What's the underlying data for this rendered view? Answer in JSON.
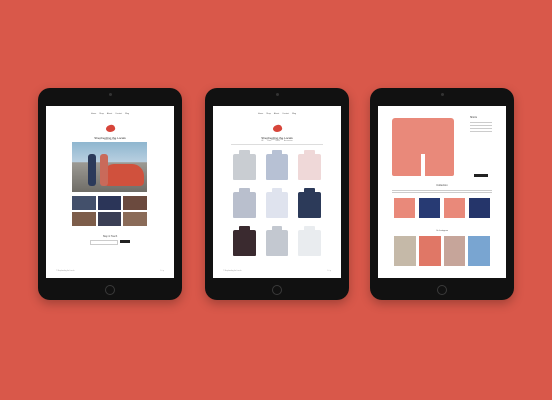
{
  "colors": {
    "background": "#d9584a",
    "brand_red": "#d7453a",
    "tablet_bezel": "#111111"
  },
  "tablet1": {
    "page": "home",
    "nav": [
      "Home",
      "Shop",
      "About",
      "Contact",
      "Blog"
    ],
    "logo_name": "Shepherding the Locals",
    "logo_tag": "Made in the USA",
    "signup_title": "Stay in Touch",
    "footer": [
      "© Shepherding the Locals",
      "f t i p"
    ]
  },
  "tablet2": {
    "page": "shop",
    "nav": [
      "Home",
      "Shop",
      "About",
      "Contact",
      "Blog"
    ],
    "logo_name": "Shepherding the Locals",
    "logo_tag": "Made in the USA",
    "filters": [
      "All",
      "Shirts",
      "Shorts",
      "Accessories"
    ],
    "shirt_colors": [
      "#c9cdd2",
      "#b7c1d4",
      "#efd8d8",
      "#b9bfcd",
      "#dfe3ee",
      "#2c3a59",
      "#3a2a2f",
      "#c3c8d0",
      "#e9ecef"
    ]
  },
  "tablet3": {
    "page": "product",
    "product_title": "Shorts",
    "collection_title": "Collection",
    "insta_title": "On Instagram",
    "collection_colors": [
      "#e9897a",
      "#273a73",
      "#e9897a",
      "#25356a"
    ],
    "photo_colors": [
      "#c5b9a8",
      "#e07766",
      "#c6a59a",
      "#79a5d1"
    ]
  }
}
